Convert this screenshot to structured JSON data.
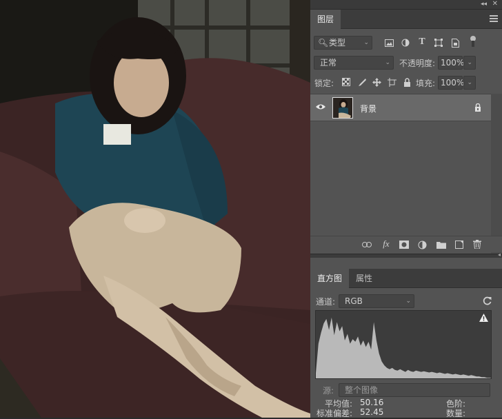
{
  "layers_panel": {
    "tab_label": "图层",
    "filter_kind": "类型",
    "blend_mode": "正常",
    "opacity_label": "不透明度:",
    "opacity_value": "100%",
    "lock_label": "锁定:",
    "fill_label": "填充:",
    "fill_value": "100%",
    "layers": [
      {
        "name": "背景",
        "visible": true,
        "locked": true
      }
    ],
    "filter_icons": [
      "image-filter-icon",
      "adjustment-filter-icon",
      "type-filter-icon",
      "shape-filter-icon",
      "smart-object-filter-icon",
      "filter-toggle-icon"
    ],
    "lock_icons": [
      "lock-transparent-icon",
      "lock-image-icon",
      "lock-position-icon",
      "lock-artboard-icon",
      "lock-all-icon"
    ],
    "bottom_icons": [
      "link-layers-icon",
      "fx-icon",
      "add-mask-icon",
      "adjustment-layer-icon",
      "new-group-icon",
      "new-layer-icon",
      "delete-layer-icon"
    ]
  },
  "histogram_panel": {
    "tabs": [
      "直方图",
      "属性"
    ],
    "active_tab": "直方图",
    "channel_label": "通道:",
    "channel_value": "RGB",
    "source_label": "源:",
    "source_value": "整个图像",
    "warning_icon": "warning-icon",
    "stats": {
      "mean_label": "平均值:",
      "mean_value": "50.16",
      "stddev_label": "标准偏差:",
      "stddev_value": "52.45",
      "level_label": "色阶:",
      "count_label": "数量:"
    },
    "histogram_levels": [
      0.1,
      0.55,
      0.72,
      0.86,
      0.93,
      0.76,
      0.95,
      0.68,
      0.88,
      0.74,
      0.82,
      0.6,
      0.7,
      0.55,
      0.62,
      0.58,
      0.66,
      0.52,
      0.6,
      0.5,
      0.58,
      0.46,
      0.88,
      0.6,
      0.4,
      0.28,
      0.22,
      0.18,
      0.16,
      0.18,
      0.15,
      0.14,
      0.16,
      0.14,
      0.12,
      0.15,
      0.13,
      0.12,
      0.14,
      0.13,
      0.12,
      0.13,
      0.12,
      0.11,
      0.12,
      0.11,
      0.1,
      0.11,
      0.1,
      0.09,
      0.1,
      0.09,
      0.08,
      0.09,
      0.08,
      0.07,
      0.08,
      0.07,
      0.06,
      0.07,
      0.06,
      0.05,
      0.05,
      0.04,
      0.04,
      0.03,
      0.03,
      0.02
    ]
  },
  "colors": {
    "panel_bg": "#535353",
    "tabbar_bg": "#3c3c3c",
    "selected_layer": "#696969",
    "histogram_fill": "#b9b9b9"
  }
}
